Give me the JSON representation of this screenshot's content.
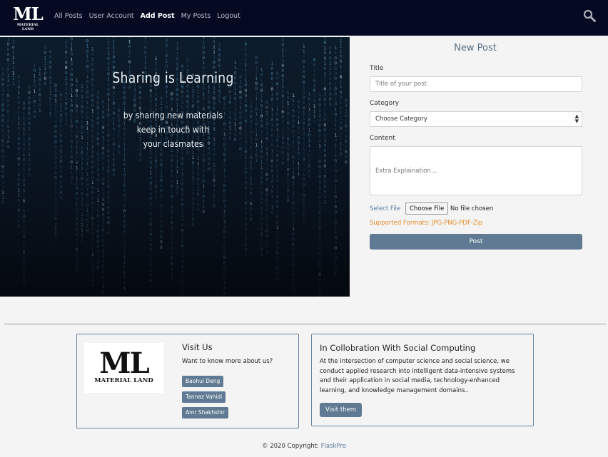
{
  "nav": {
    "logo_big": "ML",
    "logo_small": "MATERIAL LAND",
    "links": [
      "All Posts",
      "User Account",
      "Add Post",
      "My Posts",
      "Logout"
    ],
    "active_link": "Add Post",
    "search_icon": "search-icon"
  },
  "hero": {
    "title": "Sharing is Learning",
    "sub1": "by sharing new materials",
    "sub2": "keep in touch with",
    "sub3": "your clasmates"
  },
  "form": {
    "heading": "New Post",
    "title_label": "Title",
    "title_placeholder": "Title of your post",
    "category_label": "Category",
    "category_value": "Choose Category",
    "content_label": "Content",
    "content_placeholder": "Extra Explaination...",
    "file_label": "Select File",
    "file_button": "Choose File",
    "file_status": "No file chosen",
    "formats": "Supported Formats: JPG-PNG-PDF-Zip",
    "submit": "Post"
  },
  "cards": {
    "visit": {
      "logo_big": "ML",
      "logo_small": "MATERIAL LAND",
      "title": "Visit Us",
      "text": "Want to know more about us?",
      "people": [
        "Baohui Deng",
        "Tannaz Vahidi",
        "Amr Shakhshir"
      ]
    },
    "collab": {
      "title": "In Collobration With Social Computing",
      "line1": "At the intersection of computer science and social science, we",
      "line2": "conduct applied research into intelligent data-intensive systems",
      "line3": "and their application in social media, technology-enhanced",
      "line4": "learning, and knowledge management domains..",
      "button": "Visit them"
    }
  },
  "footer": {
    "text": "© 2020 Copyright: ",
    "link": "FlaskPro"
  },
  "colors": {
    "navbar": "#050a22",
    "accent": "#5f7a92",
    "formats_text": "#e58b2a",
    "link": "#5a7c9e"
  }
}
